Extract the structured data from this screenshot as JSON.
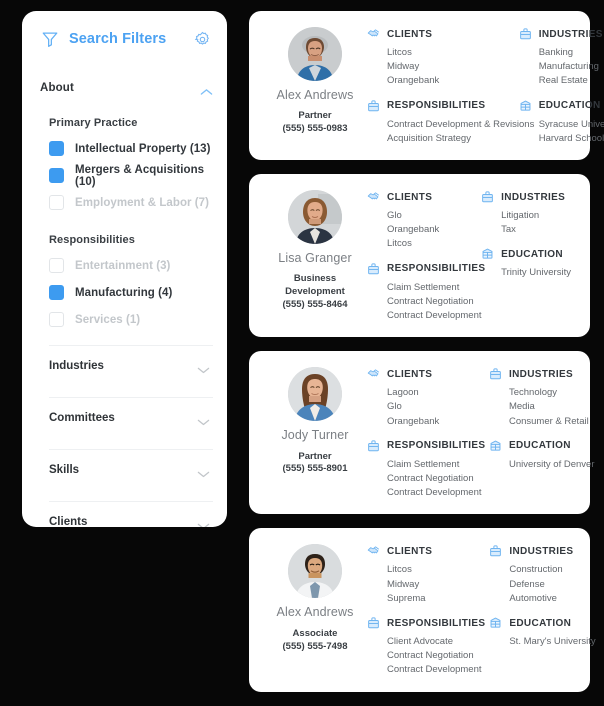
{
  "theme": {
    "background": "#070707",
    "panel": "#ffffff",
    "accent": "#4ca2f2",
    "checkbox_on": "#3d9bf0",
    "text_dark": "#32373c",
    "text_muted": "#64686d",
    "text_disabled": "#c3c7cb"
  },
  "sidebar": {
    "title": "Search Filters",
    "filter_icon": "funnel-icon",
    "gear_icon": "gear-icon",
    "sections": [
      {
        "id": "about",
        "label": "About",
        "expanded": true,
        "chevron": "chevron-up-icon",
        "groups": [
          {
            "label": "Primary Practice",
            "options": [
              {
                "label": "Intellectual Property (13)",
                "checked": true
              },
              {
                "label": "Mergers & Acquisitions (10)",
                "checked": true
              },
              {
                "label": "Employment & Labor (7)",
                "checked": false
              }
            ]
          },
          {
            "label": "Responsibilities",
            "options": [
              {
                "label": "Entertainment (3)",
                "checked": false
              },
              {
                "label": "Manufacturing (4)",
                "checked": true
              },
              {
                "label": "Services (1)",
                "checked": false
              }
            ]
          }
        ]
      },
      {
        "id": "industries",
        "label": "Industries",
        "expanded": false,
        "chevron": "chevron-down-icon"
      },
      {
        "id": "committees",
        "label": "Committees",
        "expanded": false,
        "chevron": "chevron-down-icon"
      },
      {
        "id": "skills",
        "label": "Skills",
        "expanded": false,
        "chevron": "chevron-down-icon"
      },
      {
        "id": "clients",
        "label": "Clients",
        "expanded": false,
        "chevron": "chevron-down-icon"
      }
    ]
  },
  "block_titles": {
    "clients": "CLIENTS",
    "industries": "INDUSTRIES",
    "responsibilities": "RESPONSIBILITIES",
    "education": "EDUCATION"
  },
  "block_icons": {
    "clients": "handshake-icon",
    "industries": "briefcase-icon",
    "responsibilities": "briefcase-icon",
    "education": "graduation-building-icon"
  },
  "results": [
    {
      "name": "Alex Andrews",
      "role": "Partner",
      "phone": "(555) 555-0983",
      "avatar": "avatar-male-blue-shirt",
      "clients": [
        "Litcos",
        "Midway",
        "Orangebank"
      ],
      "industries": [
        "Banking",
        "Manufacturing",
        "Real Estate"
      ],
      "responsibilities": [
        "Contract Development & Revisions",
        "Acquisition Strategy"
      ],
      "education": [
        "Syracuse University",
        "Harvard School of Law"
      ]
    },
    {
      "name": "Lisa Granger",
      "role": "Business Development",
      "phone": "(555) 555-8464",
      "avatar": "avatar-female-dark-jacket",
      "clients": [
        "Glo",
        "Orangebank",
        "Litcos"
      ],
      "industries": [
        "Litigation",
        "Tax"
      ],
      "responsibilities": [
        "Claim Settlement",
        "Contract Negotiation",
        "Contract Development"
      ],
      "education": [
        "Trinity University"
      ]
    },
    {
      "name": "Jody Turner",
      "role": "Partner",
      "phone": "(555) 555-8901",
      "avatar": "avatar-female-brown-hair",
      "clients": [
        "Lagoon",
        "Glo",
        "Orangebank"
      ],
      "industries": [
        "Technology",
        "Media",
        "Consumer & Retail"
      ],
      "responsibilities": [
        "Claim Settlement",
        "Contract Negotiation",
        "Contract Development"
      ],
      "education": [
        "University of Denver"
      ]
    },
    {
      "name": "Alex Andrews",
      "role": "Associate",
      "phone": "(555) 555-7498",
      "avatar": "avatar-male-white-shirt",
      "clients": [
        "Litcos",
        "Midway",
        "Suprema"
      ],
      "industries": [
        "Construction",
        "Defense",
        "Automotive"
      ],
      "responsibilities": [
        "Client Advocate",
        "Contract Negotiation",
        "Contract Development"
      ],
      "education": [
        "St. Mary's University"
      ]
    }
  ]
}
